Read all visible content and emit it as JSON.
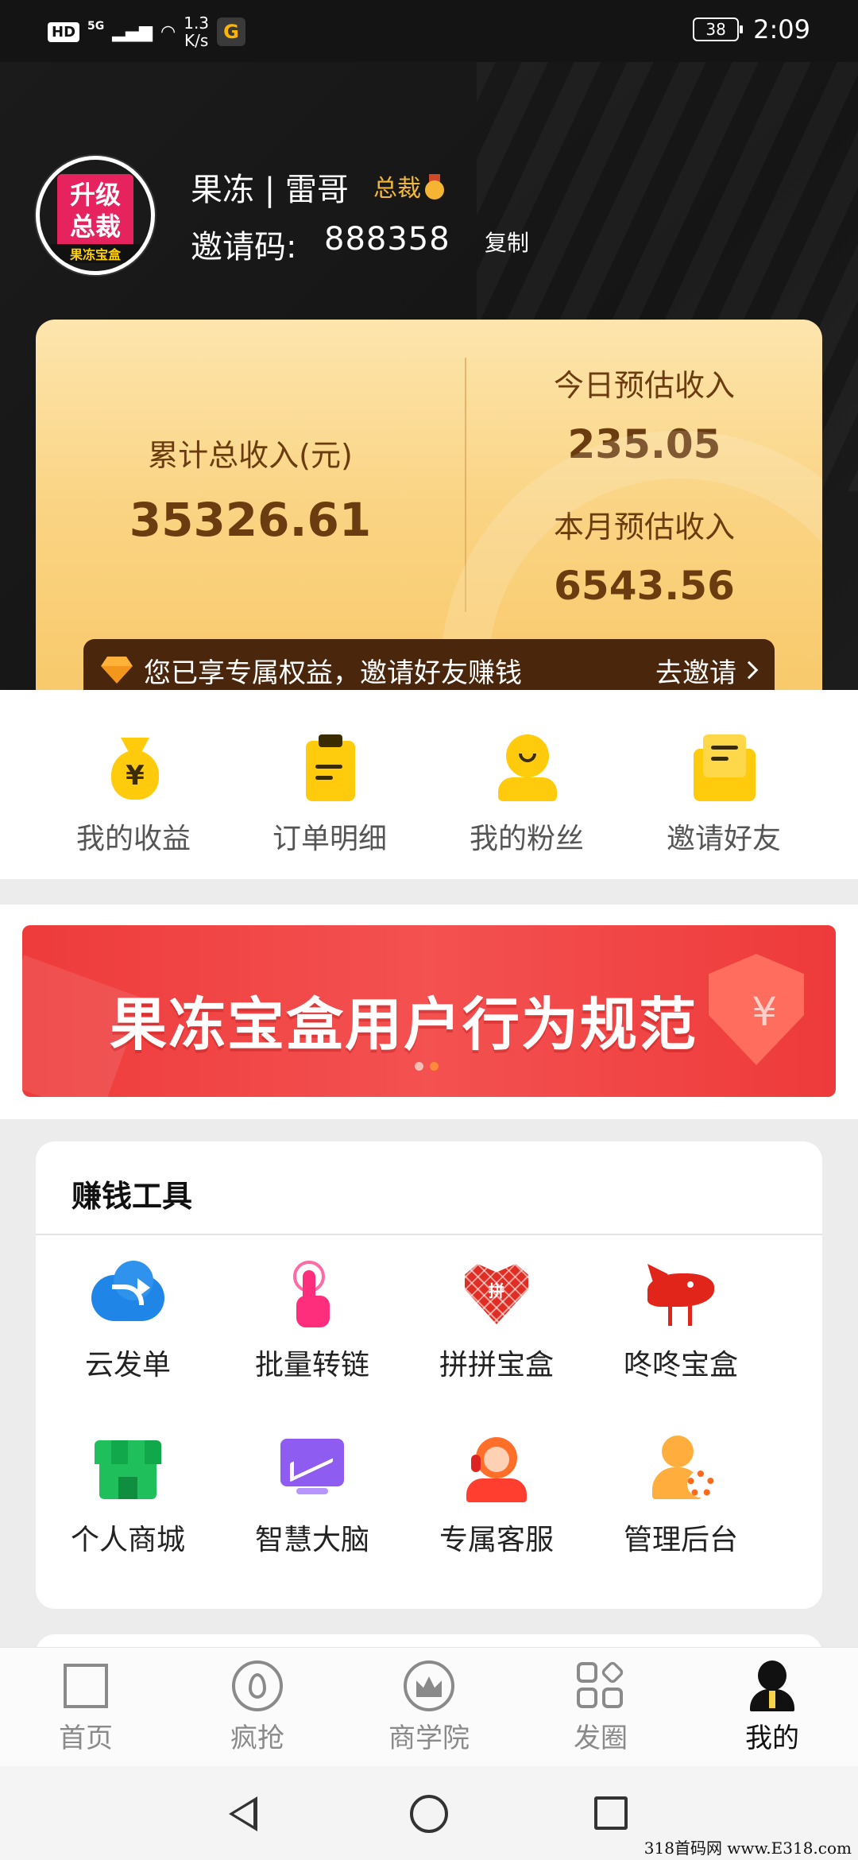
{
  "status_bar": {
    "hd": "HD",
    "network": "5G",
    "speed_value": "1.3",
    "speed_unit": "K/s",
    "app_icon": "G",
    "battery": "38",
    "time": "2:09"
  },
  "profile": {
    "avatar_line1": "升级",
    "avatar_line2": "总裁",
    "avatar_sub": "果冻宝盒",
    "name": "果冻 | 雷哥",
    "rank": "总裁",
    "invite_label": "邀请码:",
    "invite_code": "888358",
    "copy_label": "复制"
  },
  "income": {
    "total_label": "累计总收入(元)",
    "total_value": "35326.61",
    "today_label": "今日预估收入",
    "today_value": "235.05",
    "month_label": "本月预估收入",
    "month_value": "6543.56",
    "invite_text": "您已享专属权益，邀请好友赚钱",
    "invite_action": "去邀请"
  },
  "quick_menu": [
    {
      "label": "我的收益",
      "icon": "money-bag-icon"
    },
    {
      "label": "订单明细",
      "icon": "clipboard-icon"
    },
    {
      "label": "我的粉丝",
      "icon": "fans-icon"
    },
    {
      "label": "邀请好友",
      "icon": "invite-envelope-icon"
    }
  ],
  "banner": {
    "title": "果冻宝盒用户行为规范",
    "slides": 2,
    "active_slide": 2
  },
  "tools": {
    "title": "赚钱工具",
    "items": [
      {
        "label": "云发单",
        "icon": "cloud-share-icon"
      },
      {
        "label": "批量转链",
        "icon": "tap-hand-icon"
      },
      {
        "label": "拼拼宝盒",
        "icon": "pinduoduo-icon",
        "icon_text": "拼"
      },
      {
        "label": "咚咚宝盒",
        "icon": "jd-dog-icon"
      },
      {
        "label": "个人商城",
        "icon": "shop-icon"
      },
      {
        "label": "智慧大脑",
        "icon": "chart-screen-icon"
      },
      {
        "label": "专属客服",
        "icon": "customer-service-icon"
      },
      {
        "label": "管理后台",
        "icon": "admin-gear-icon"
      }
    ]
  },
  "bottom_nav": [
    {
      "label": "首页",
      "icon": "home-icon"
    },
    {
      "label": "疯抢",
      "icon": "flame-icon"
    },
    {
      "label": "商学院",
      "icon": "crown-icon"
    },
    {
      "label": "发圈",
      "icon": "grid-icon"
    },
    {
      "label": "我的",
      "icon": "profile-icon",
      "active": true
    }
  ],
  "watermark": "318首码网 www.E318.com",
  "colors": {
    "header_bg": "#151515",
    "card_gold": "#fad484",
    "income_text": "#6a3c10",
    "banner_red": "#ee3b3b",
    "accent_yellow": "#ffcb0c"
  }
}
